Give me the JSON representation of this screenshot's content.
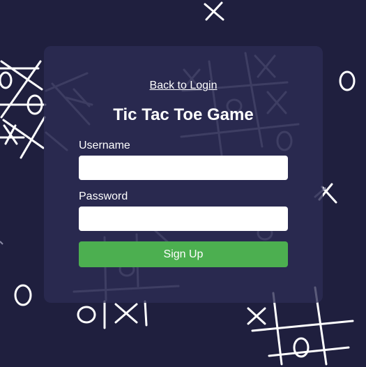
{
  "page": {
    "background_color": "#1f1f3e",
    "card_color": "#2d2d55",
    "accent_color": "#4caf50"
  },
  "signup": {
    "back_link_label": "Back to Login",
    "title": "Tic Tac Toe Game",
    "username_label": "Username",
    "username_value": "",
    "password_label": "Password",
    "password_value": "",
    "submit_label": "Sign Up"
  },
  "decorations": {
    "icon": "tic-tac-toe-doodles"
  }
}
